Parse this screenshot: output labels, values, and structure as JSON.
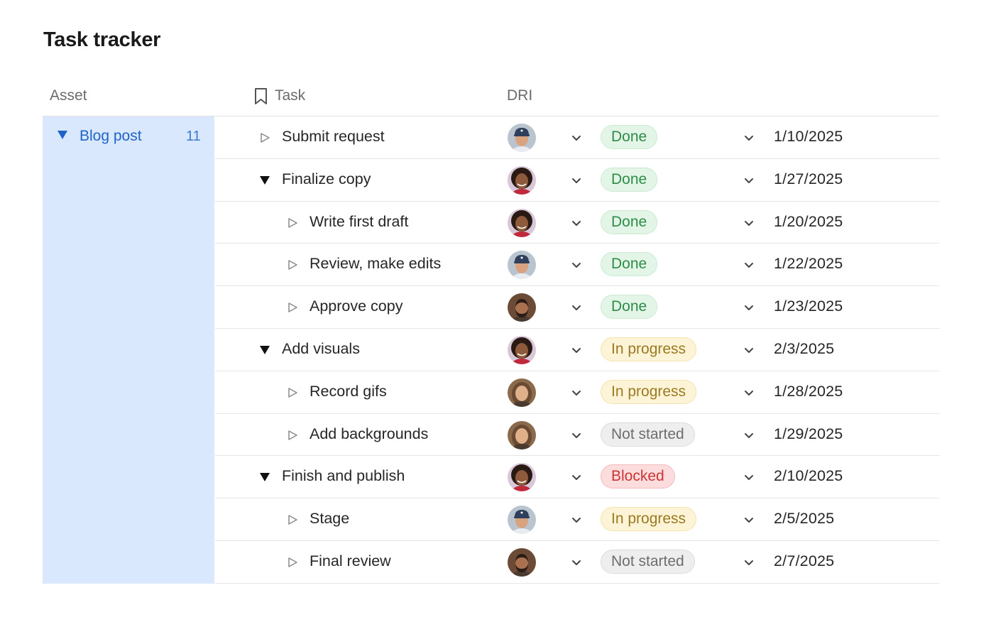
{
  "title": "Task tracker",
  "headers": {
    "asset": "Asset",
    "task": "Task",
    "dri": "DRI"
  },
  "asset": {
    "name": "Blog post",
    "count": "11"
  },
  "colors": {
    "asset_bg": "#d9e8fc",
    "asset_text": "#1f63c8",
    "done": "#2e8c48",
    "in_progress": "#9a7a22",
    "not_started": "#6e6e6e",
    "blocked": "#c93636"
  },
  "tasks": [
    {
      "name": "Submit request",
      "level": 0,
      "toggle": "collapsed",
      "dri": "person-cap",
      "status": "Done",
      "status_key": "done",
      "date": "1/10/2025"
    },
    {
      "name": "Finalize copy",
      "level": 0,
      "toggle": "expanded",
      "dri": "person-curly",
      "status": "Done",
      "status_key": "done",
      "date": "1/27/2025"
    },
    {
      "name": "Write first draft",
      "level": 1,
      "toggle": "collapsed",
      "dri": "person-curly",
      "status": "Done",
      "status_key": "done",
      "date": "1/20/2025"
    },
    {
      "name": "Review, make edits",
      "level": 1,
      "toggle": "collapsed",
      "dri": "person-cap",
      "status": "Done",
      "status_key": "done",
      "date": "1/22/2025"
    },
    {
      "name": "Approve copy",
      "level": 1,
      "toggle": "collapsed",
      "dri": "person-bearded",
      "status": "Done",
      "status_key": "done",
      "date": "1/23/2025"
    },
    {
      "name": "Add visuals",
      "level": 0,
      "toggle": "expanded",
      "dri": "person-curly",
      "status": "In progress",
      "status_key": "progress",
      "date": "2/3/2025"
    },
    {
      "name": "Record gifs",
      "level": 1,
      "toggle": "collapsed",
      "dri": "person-longhair",
      "status": "In progress",
      "status_key": "progress",
      "date": "1/28/2025"
    },
    {
      "name": "Add backgrounds",
      "level": 1,
      "toggle": "collapsed",
      "dri": "person-longhair",
      "status": "Not started",
      "status_key": "notstarted",
      "date": "1/29/2025"
    },
    {
      "name": "Finish and publish",
      "level": 0,
      "toggle": "expanded",
      "dri": "person-curly",
      "status": "Blocked",
      "status_key": "blocked",
      "date": "2/10/2025"
    },
    {
      "name": "Stage",
      "level": 1,
      "toggle": "collapsed",
      "dri": "person-cap",
      "status": "In progress",
      "status_key": "progress",
      "date": "2/5/2025"
    },
    {
      "name": "Final review",
      "level": 1,
      "toggle": "collapsed",
      "dri": "person-bearded",
      "status": "Not started",
      "status_key": "notstarted",
      "date": "2/7/2025"
    }
  ]
}
